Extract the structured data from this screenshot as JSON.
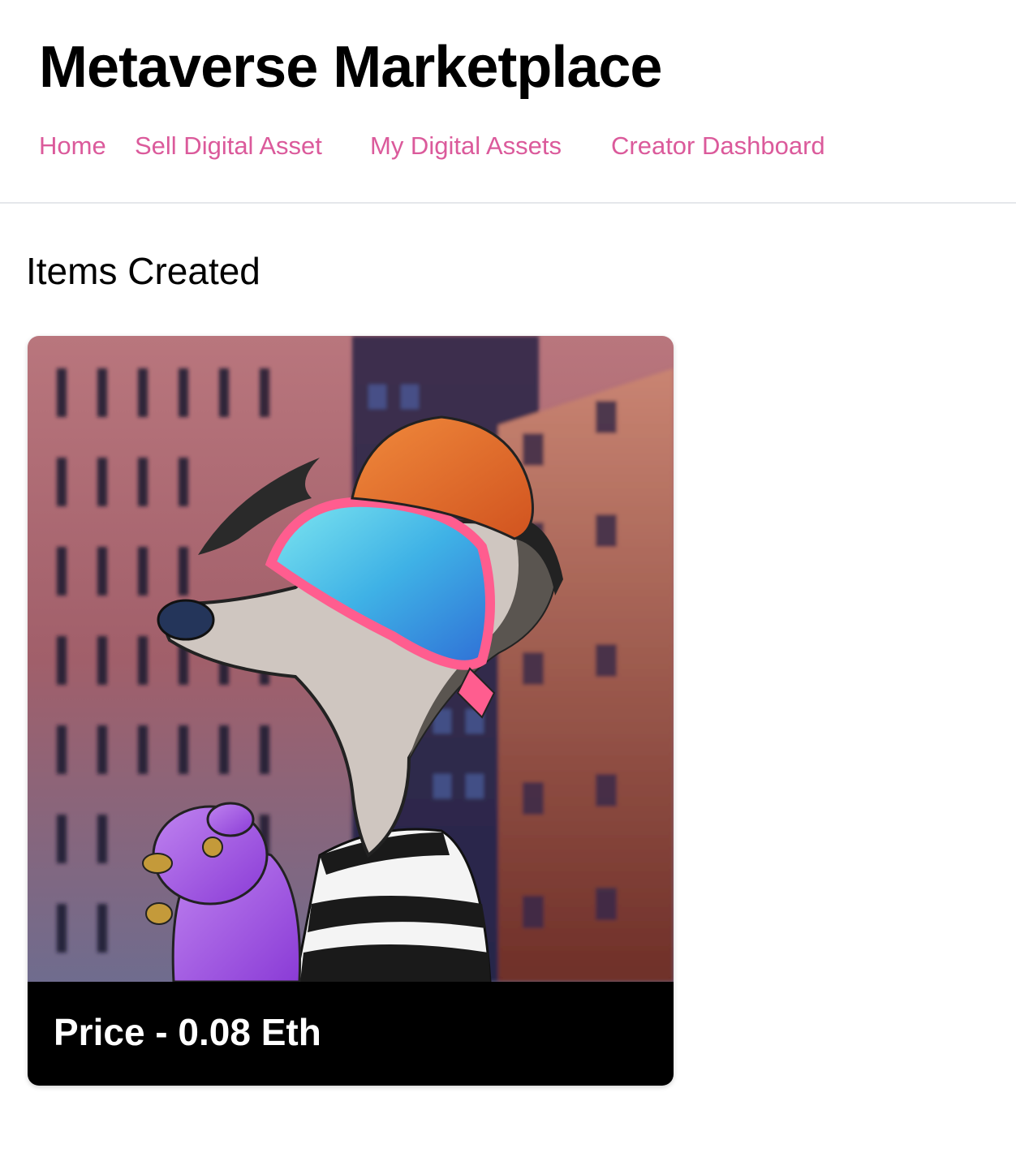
{
  "header": {
    "title": "Metaverse Marketplace",
    "nav": [
      {
        "label": "Home"
      },
      {
        "label": "Sell Digital Asset"
      },
      {
        "label": "My Digital Assets"
      },
      {
        "label": "Creator Dashboard"
      }
    ]
  },
  "main": {
    "section_title": "Items Created",
    "items": [
      {
        "image_subject": "meerkat-nft-artwork",
        "price_text": "Price - 0.08 Eth"
      }
    ]
  },
  "colors": {
    "nav_link": "#db5a9b",
    "card_footer": "#000000",
    "divider": "#e5e7eb"
  }
}
